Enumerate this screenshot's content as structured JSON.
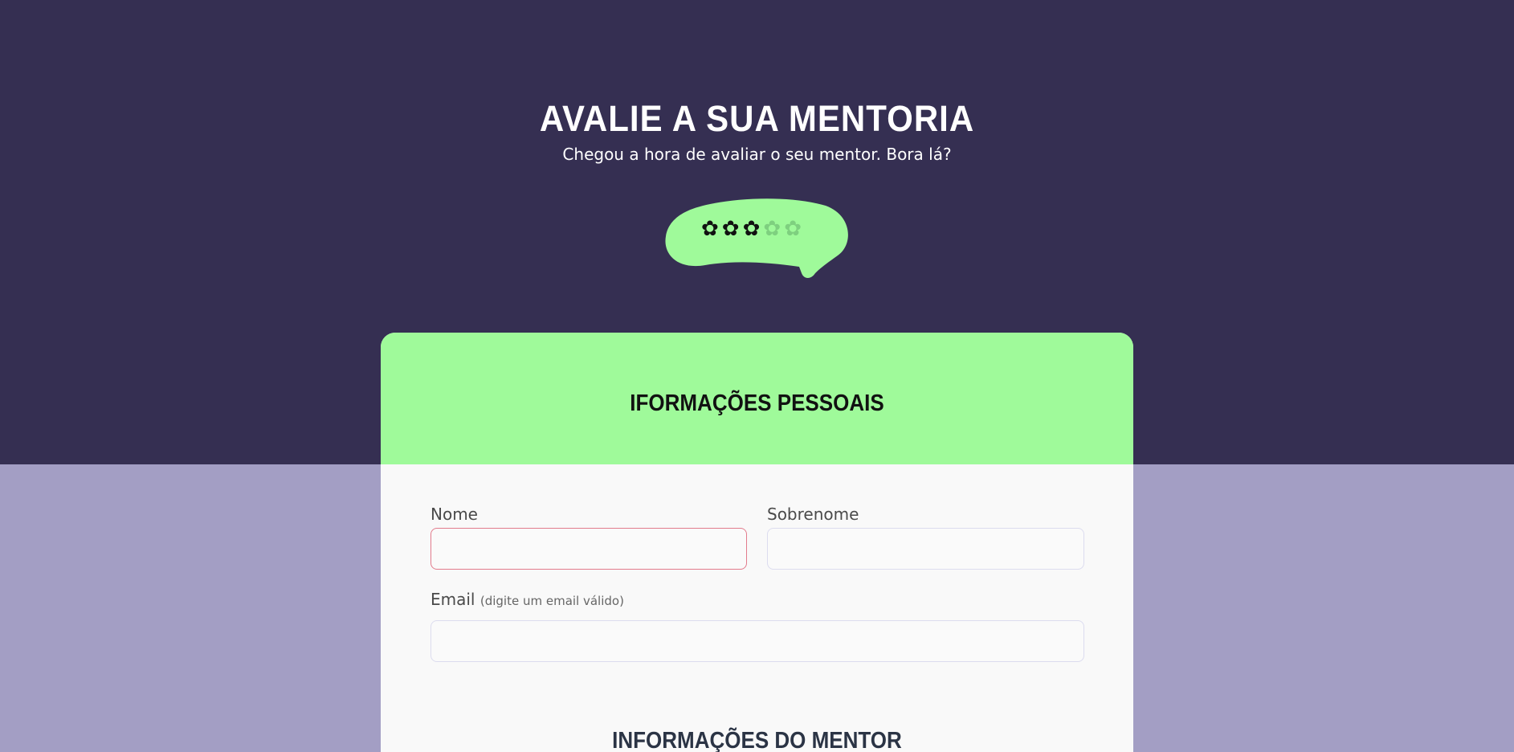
{
  "hero": {
    "title": "AVALIE A SUA MENTORIA",
    "subtitle": "Chegou a hora de avaliar o seu mentor. Bora lá?"
  },
  "rating": {
    "value": 3,
    "max": 5,
    "star_icon": "star-icon",
    "bubble_color": "#9ffa9a"
  },
  "form": {
    "header_title": "IFORMAÇÕES PESSOAIS",
    "fields": {
      "nome": {
        "label": "Nome",
        "value": "",
        "placeholder": ""
      },
      "sobrenome": {
        "label": "Sobrenome",
        "value": "",
        "placeholder": ""
      },
      "email": {
        "label": "Email",
        "hint": "(digite um email válido)",
        "value": "",
        "placeholder": ""
      }
    },
    "mentor_section_title": "INFORMAÇÕES DO MENTOR"
  },
  "colors": {
    "dark_bg": "#352f52",
    "light_bg": "#a39ec4",
    "accent_green": "#9ffa9a",
    "error_border": "#e27b8c"
  }
}
